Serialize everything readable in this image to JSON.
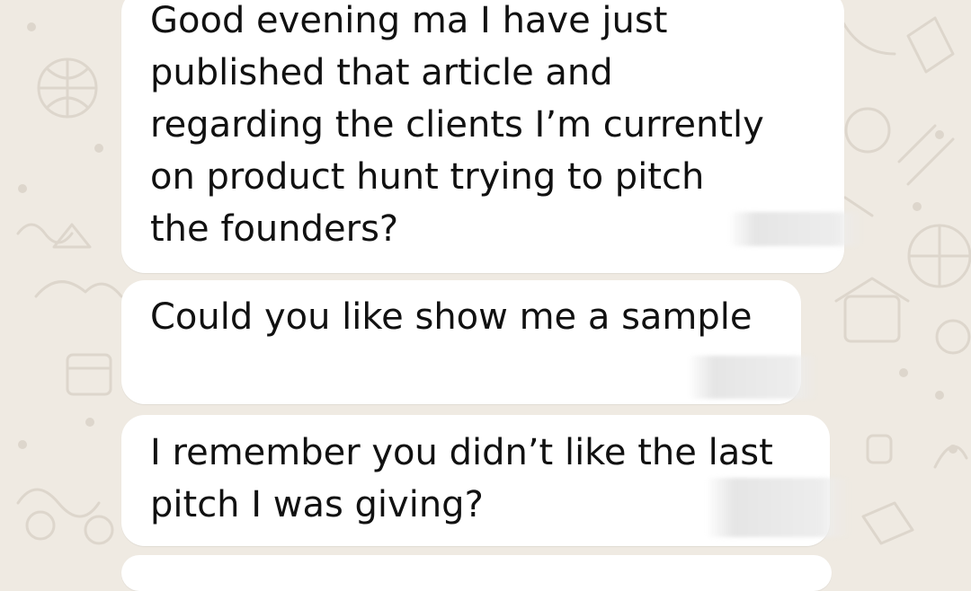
{
  "chat": {
    "messages": [
      {
        "text": "Good evening ma I have just\npublished that article and\nregarding the clients I’m currently\non product hunt trying to pitch\nthe founders?"
      },
      {
        "text": "Could you like show me a sample"
      },
      {
        "text": "I remember you didn’t like the last\npitch I was giving?"
      },
      {
        "text": ""
      }
    ]
  },
  "colors": {
    "wallpaper": "#efeae2",
    "bubble": "#ffffff",
    "text": "#111111"
  }
}
